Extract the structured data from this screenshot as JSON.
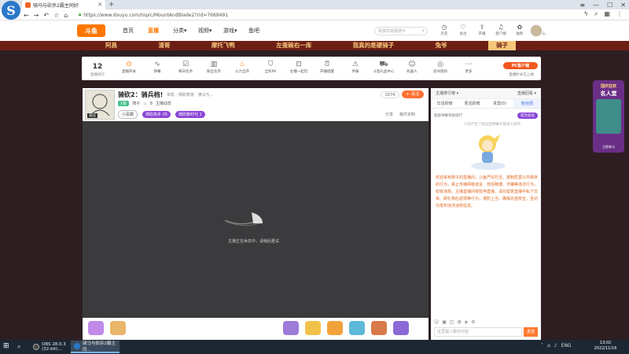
{
  "browser": {
    "tab_title": "骑马与砍杀2霸主同好",
    "url": "https://www.douyu.com/topic/MountAndBlade2?rid=7669491",
    "window_controls": [
      "≡",
      "—",
      "☐",
      "✕"
    ]
  },
  "site": {
    "logo_text": "斗鱼",
    "nav": [
      "首页",
      "直播",
      "分类▾",
      "视频▾",
      "游戏▾",
      "鱼吧"
    ],
    "nav_active_index": 1,
    "search_placeholder": "我真的是硬骑子",
    "header_icons": [
      {
        "icon": "history-icon",
        "label": "历史"
      },
      {
        "icon": "heart-icon",
        "label": "关注"
      },
      {
        "icon": "upload-icon",
        "label": "开播"
      },
      {
        "icon": "bell-icon",
        "label": "客户端"
      },
      {
        "icon": "gift-icon",
        "label": "福利"
      },
      {
        "icon": "shield-icon",
        "label": "会员中心"
      }
    ],
    "category_banner": [
      "阿昌",
      "渣哥",
      "摩托飞鸭",
      "左蛋碗右一库",
      "我真的是硬骑子",
      "兔爷",
      "骑子"
    ],
    "category_selected_index": 6
  },
  "toolbar": {
    "rank_number": "12",
    "rank_label": "直播排行",
    "items": [
      {
        "icon": "toggle-icon",
        "label": "直播开关",
        "hot": true
      },
      {
        "icon": "waveform-icon",
        "label": "弹幕"
      },
      {
        "icon": "check-icon",
        "label": "每日任务"
      },
      {
        "icon": "bar-chart-icon",
        "label": "粉丝任务"
      },
      {
        "icon": "fire-icon",
        "label": "火力全开",
        "hot": true
      },
      {
        "icon": "shield-icon",
        "label": "全民PK"
      },
      {
        "icon": "play-icon",
        "label": "主播一起玩"
      },
      {
        "icon": "bell-icon",
        "label": "开播提醒"
      },
      {
        "icon": "warning-icon",
        "label": "举报"
      },
      {
        "icon": "car-icon",
        "label": "斗鱼礼品中心"
      },
      {
        "icon": "robot-icon",
        "label": "机器人"
      },
      {
        "icon": "compass-icon",
        "label": "房间装扮"
      },
      {
        "icon": "more-icon",
        "label": "更多"
      }
    ],
    "pc_client_label": "PC客户端",
    "pc_client_sub": "直播时长已上线"
  },
  "room": {
    "title": "骑砍2：骑兵档!",
    "meta": "单机 · 骑砍热游 · 骑马与...",
    "level_badge": "1级",
    "streamer": "骑子",
    "hot": "8",
    "report": "主播动态",
    "tags": [
      "小恶霸",
      "骑砍高手 25",
      "骑砍新时代 1"
    ],
    "follow_count": "1074",
    "follow_label": "+ 关注",
    "share": [
      "分享",
      "稿件定制"
    ],
    "avatar_label": "骑兵"
  },
  "video": {
    "status_text": "主播正在休息中，请稍后重试"
  },
  "chat": {
    "top_left": "主播排行榜 ▾",
    "top_right": "直播回看 ▾",
    "tabs": [
      "日活跃榜",
      "周活跃榜",
      "贵宾(0)",
      "粉丝团"
    ],
    "active_tab_index": 3,
    "sub_left": "超级弹幕等级排行",
    "sub_right": "成为会员",
    "empty_text": "只有产生了粉丝团弹幕才能进入榜单",
    "notice": "欢迎来到骑子的直播间，斗鱼严厉打击、抵制危害公共秩序的行为，禁止传播网络谣言、低俗赌博、诈骗等违法行为，如有违规，主播直播间将暂停直播，请勿留意直播中私下交易、刷礼物后返现等行为，谨防上当，确保充值安全，且切勿发布违法违规信息。",
    "input_placeholder": "这里输入聊天内容",
    "send_label": "发送"
  },
  "promo": {
    "title1": "国庆狂欢",
    "title2": "名人堂",
    "bottom": "立即参与"
  },
  "taskbar": {
    "apps": [
      "OBS 28.0.3 (32-bit)...",
      "骑马与砍杀2霸主同..."
    ],
    "tray": [
      "ENG"
    ],
    "time": "13:02",
    "date": "2022/11/16"
  },
  "colors": {
    "accent": "#ff7a2f",
    "banner_bg": "#6d1f14",
    "banner_text": "#f6c77a",
    "page_bg": "#2e1e22",
    "purple": "#8b46d6"
  }
}
